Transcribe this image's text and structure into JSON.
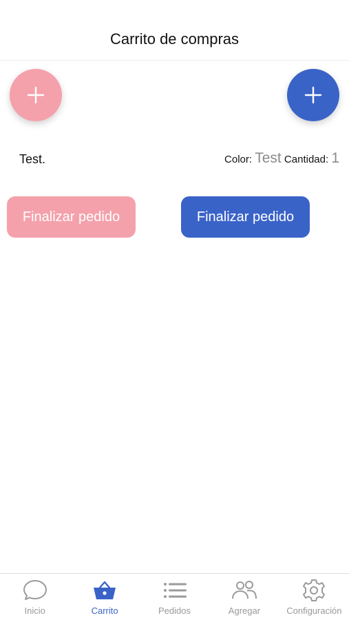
{
  "header": {
    "title": "Carrito de compras"
  },
  "colors": {
    "pink": "#f4a1ab",
    "blue": "#3a63c8",
    "muted": "#8a8a8a",
    "tab_inactive": "#999999"
  },
  "fabs": {
    "left_icon": "plus-icon",
    "right_icon": "plus-icon"
  },
  "cart_item": {
    "name": "Test.",
    "color_label": "Color:",
    "color_value": "Test",
    "quantity_label": "Cantidad:",
    "quantity_value": "1"
  },
  "buttons": {
    "finish_left": "Finalizar pedido",
    "finish_right": "Finalizar pedido"
  },
  "tabbar": {
    "tabs": [
      {
        "label": "Inicio",
        "icon": "chat-bubble-icon",
        "active": false
      },
      {
        "label": "Carrito",
        "icon": "basket-icon",
        "active": true
      },
      {
        "label": "Pedidos",
        "icon": "list-icon",
        "active": false
      },
      {
        "label": "Agregar",
        "icon": "users-icon",
        "active": false
      },
      {
        "label": "Configuración",
        "icon": "gear-icon",
        "active": false
      }
    ]
  }
}
